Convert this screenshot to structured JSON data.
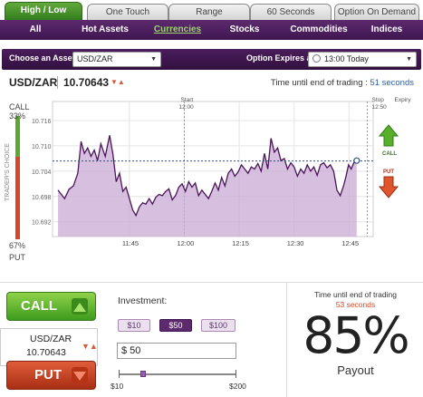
{
  "tabs": [
    {
      "label": "High / Low",
      "active": true
    },
    {
      "label": "One Touch",
      "active": false
    },
    {
      "label": "Range",
      "active": false
    },
    {
      "label": "60 Seconds",
      "active": false
    },
    {
      "label": "Option On Demand",
      "active": false
    }
  ],
  "nav": [
    {
      "label": "All",
      "active": false
    },
    {
      "label": "Hot Assets",
      "active": false
    },
    {
      "label": "Currencies",
      "active": true
    },
    {
      "label": "Stocks",
      "active": false
    },
    {
      "label": "Commodities",
      "active": false
    },
    {
      "label": "Indices",
      "active": false
    }
  ],
  "assetbar": {
    "asset_label": "Choose an Asset:",
    "asset_value": "USD/ZAR",
    "expiry_label": "Option Expires at:",
    "expiry_value": "13:00 Today"
  },
  "quote": {
    "asset": "USD/ZAR",
    "price": "10.70643",
    "time_left_prefix": "Time until end of trading :",
    "time_left_value": "51 seconds"
  },
  "chart_data": {
    "type": "area",
    "x_ticks": [
      "11:45",
      "12:00",
      "12:15",
      "12:30",
      "12:45"
    ],
    "y_ticks": [
      "10.716",
      "10.710",
      "10.704",
      "10.698",
      "10.692"
    ],
    "start_label": "Start",
    "start_time": "12:00",
    "stop_label": "Stop",
    "stop_time": "12:50",
    "expiry_label": "Expiry",
    "current_level": 10.7064,
    "ylim": [
      10.6885,
      10.7205
    ],
    "series": [
      {
        "values": [
          [
            11.425,
            10.6995
          ],
          [
            11.455,
            10.6975
          ],
          [
            11.475,
            10.6997
          ],
          [
            11.495,
            10.7005
          ],
          [
            11.515,
            10.7035
          ],
          [
            11.53,
            10.711
          ],
          [
            11.545,
            10.7082
          ],
          [
            11.56,
            10.7095
          ],
          [
            11.575,
            10.7075
          ],
          [
            11.59,
            10.709
          ],
          [
            11.605,
            10.7065
          ],
          [
            11.62,
            10.7105
          ],
          [
            11.64,
            10.7075
          ],
          [
            11.66,
            10.7125
          ],
          [
            11.675,
            10.708
          ],
          [
            11.69,
            10.7015
          ],
          [
            11.705,
            10.7035
          ],
          [
            11.72,
            10.6992
          ],
          [
            11.735,
            10.7002
          ],
          [
            11.75,
            10.6975
          ],
          [
            11.765,
            10.6948
          ],
          [
            11.78,
            10.6935
          ],
          [
            11.795,
            10.6955
          ],
          [
            11.81,
            10.6965
          ],
          [
            11.825,
            10.6962
          ],
          [
            11.84,
            10.6975
          ],
          [
            11.855,
            10.6962
          ],
          [
            11.87,
            10.6978
          ],
          [
            11.885,
            10.6985
          ],
          [
            11.9,
            10.6982
          ],
          [
            11.915,
            10.6992
          ],
          [
            11.93,
            10.6998
          ],
          [
            11.945,
            10.6972
          ],
          [
            11.96,
            10.6982
          ],
          [
            11.975,
            10.7002
          ],
          [
            11.99,
            10.701
          ],
          [
            12.005,
            10.6992
          ],
          [
            12.02,
            10.7015
          ],
          [
            12.035,
            10.7002
          ],
          [
            12.05,
            10.7012
          ],
          [
            12.065,
            10.6982
          ],
          [
            12.08,
            10.6995
          ],
          [
            12.095,
            10.6985
          ],
          [
            12.11,
            10.6975
          ],
          [
            12.125,
            10.6992
          ],
          [
            12.14,
            10.7012
          ],
          [
            12.155,
            10.6995
          ],
          [
            12.17,
            10.7025
          ],
          [
            12.185,
            10.7005
          ],
          [
            12.2,
            10.7035
          ],
          [
            12.215,
            10.7045
          ],
          [
            12.23,
            10.7028
          ],
          [
            12.245,
            10.7038
          ],
          [
            12.26,
            10.7055
          ],
          [
            12.275,
            10.7045
          ],
          [
            12.29,
            10.7035
          ],
          [
            12.305,
            10.705
          ],
          [
            12.32,
            10.7045
          ],
          [
            12.335,
            10.7058
          ],
          [
            12.35,
            10.704
          ],
          [
            12.365,
            10.7082
          ],
          [
            12.38,
            10.7045
          ],
          [
            12.395,
            10.7118
          ],
          [
            12.41,
            10.7085
          ],
          [
            12.425,
            10.7095
          ],
          [
            12.44,
            10.7065
          ],
          [
            12.455,
            10.707
          ],
          [
            12.47,
            10.7045
          ],
          [
            12.485,
            10.706
          ],
          [
            12.5,
            10.705
          ],
          [
            12.515,
            10.7028
          ],
          [
            12.53,
            10.7045
          ],
          [
            12.545,
            10.7035
          ],
          [
            12.56,
            10.7055
          ],
          [
            12.575,
            10.704
          ],
          [
            12.59,
            10.705
          ],
          [
            12.605,
            10.703
          ],
          [
            12.62,
            10.7055
          ],
          [
            12.635,
            10.706
          ],
          [
            12.65,
            10.7048
          ],
          [
            12.665,
            10.7055
          ],
          [
            12.68,
            10.704
          ],
          [
            12.695,
            10.6995
          ],
          [
            12.71,
            10.6982
          ],
          [
            12.725,
            10.7005
          ],
          [
            12.735,
            10.7025
          ],
          [
            12.748,
            10.7055
          ],
          [
            12.76,
            10.7045
          ],
          [
            12.772,
            10.706
          ],
          [
            12.785,
            10.7065
          ]
        ]
      }
    ],
    "x_range": [
      11.4,
      12.86
    ],
    "grid": true,
    "call_color": "#5aa82e",
    "put_color": "#d8452a",
    "area_color": "#c9a9d4",
    "line_color": "#4a1458"
  },
  "sentiment": {
    "call_label": "CALL",
    "call_pct": "33%",
    "put_label": "PUT",
    "put_pct": "67%",
    "title": "TRADER'S CHOICE",
    "call_fraction": 0.33
  },
  "chart_buttons": {
    "call": "CALL",
    "put": "PUT"
  },
  "trade": {
    "call_button": "CALL",
    "put_button": "PUT",
    "investment_label": "Investment:",
    "amounts": [
      {
        "label": "$10",
        "selected": false
      },
      {
        "label": "$50",
        "selected": true
      },
      {
        "label": "$100",
        "selected": false
      }
    ],
    "input_value": "$ 50",
    "slider_min": "$10",
    "slider_max": "$200",
    "slider_value": 50
  },
  "payout": {
    "time_label": "Time until end of trading",
    "time_value": "53 seconds",
    "percent": "85%",
    "label": "Payout"
  }
}
